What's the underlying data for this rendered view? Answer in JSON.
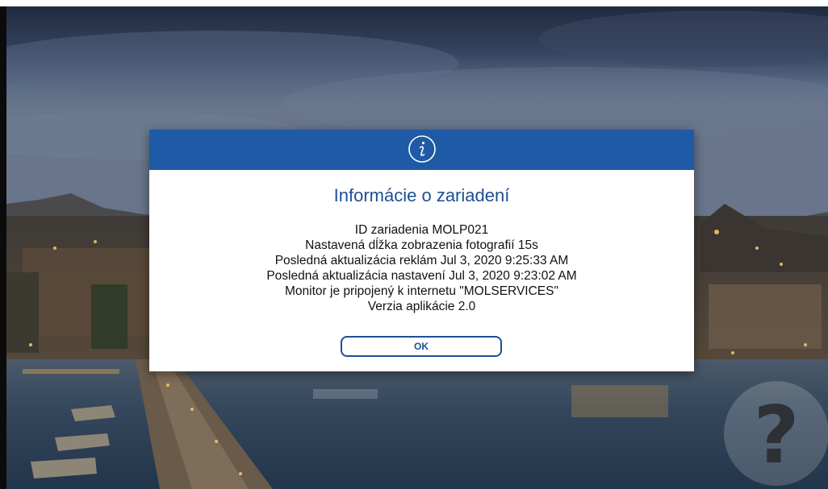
{
  "dialog": {
    "icon": "info-icon",
    "title": "Informácie o zariadení",
    "lines": [
      "ID zariadenia MOLP021",
      "Nastavená dĺžka zobrazenia fotografií 15s",
      "Posledná aktualizácia reklám Jul 3, 2020 9:25:33 AM",
      "Posledná aktualizácia nastavení Jul 3, 2020 9:23:02 AM",
      "Monitor je pripojený k internetu \"MOLSERVICES\"",
      "Verzia aplikácie 2.0"
    ],
    "ok_label": "OK",
    "header_color": "#1e5aa6",
    "title_color": "#1e4f93"
  },
  "help_button": {
    "icon": "question-mark-icon",
    "glyph": "?"
  }
}
